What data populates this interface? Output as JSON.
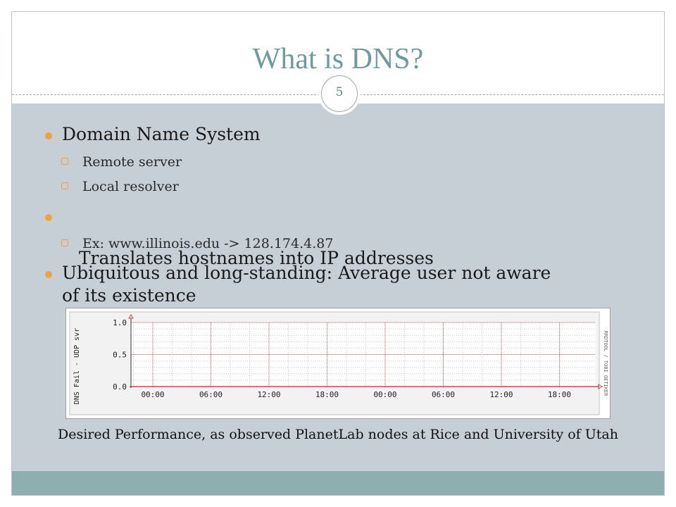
{
  "slide": {
    "title": "What is DNS?",
    "page_number": "5"
  },
  "bullets": [
    {
      "text": "Domain Name System",
      "subitems": [
        "Remote server",
        "Local resolver"
      ]
    },
    {
      "text": " Translates hostnames into IP addresses",
      "subitems": [
        "Ex: www.illinois.edu -> 128.174.4.87"
      ]
    },
    {
      "text_line1": "Ubiquitous and long-standing: Average user not aware",
      "text_line2": "of its existence"
    }
  ],
  "caption": "Desired Performance, as observed PlanetLab nodes at Rice and University of Utah",
  "chart_data": {
    "type": "line",
    "ylabel": "DNS Fail - UDP svr",
    "side_label": "RRDTOOL / TOBI OETIKER",
    "y_ticks": [
      "1.0",
      "0.5",
      "0.0"
    ],
    "ylim": [
      0,
      1
    ],
    "categories": [
      "00:00",
      "06:00",
      "12:00",
      "18:00",
      "00:00",
      "06:00",
      "12:00",
      "18:00"
    ],
    "series": [
      {
        "values": [
          0,
          0,
          0,
          0,
          0,
          0,
          0,
          0
        ]
      }
    ],
    "grid": true,
    "colors": {
      "grid_major": "#e05050",
      "grid_minor": "#c8c8c8",
      "line": "#e04040"
    }
  }
}
